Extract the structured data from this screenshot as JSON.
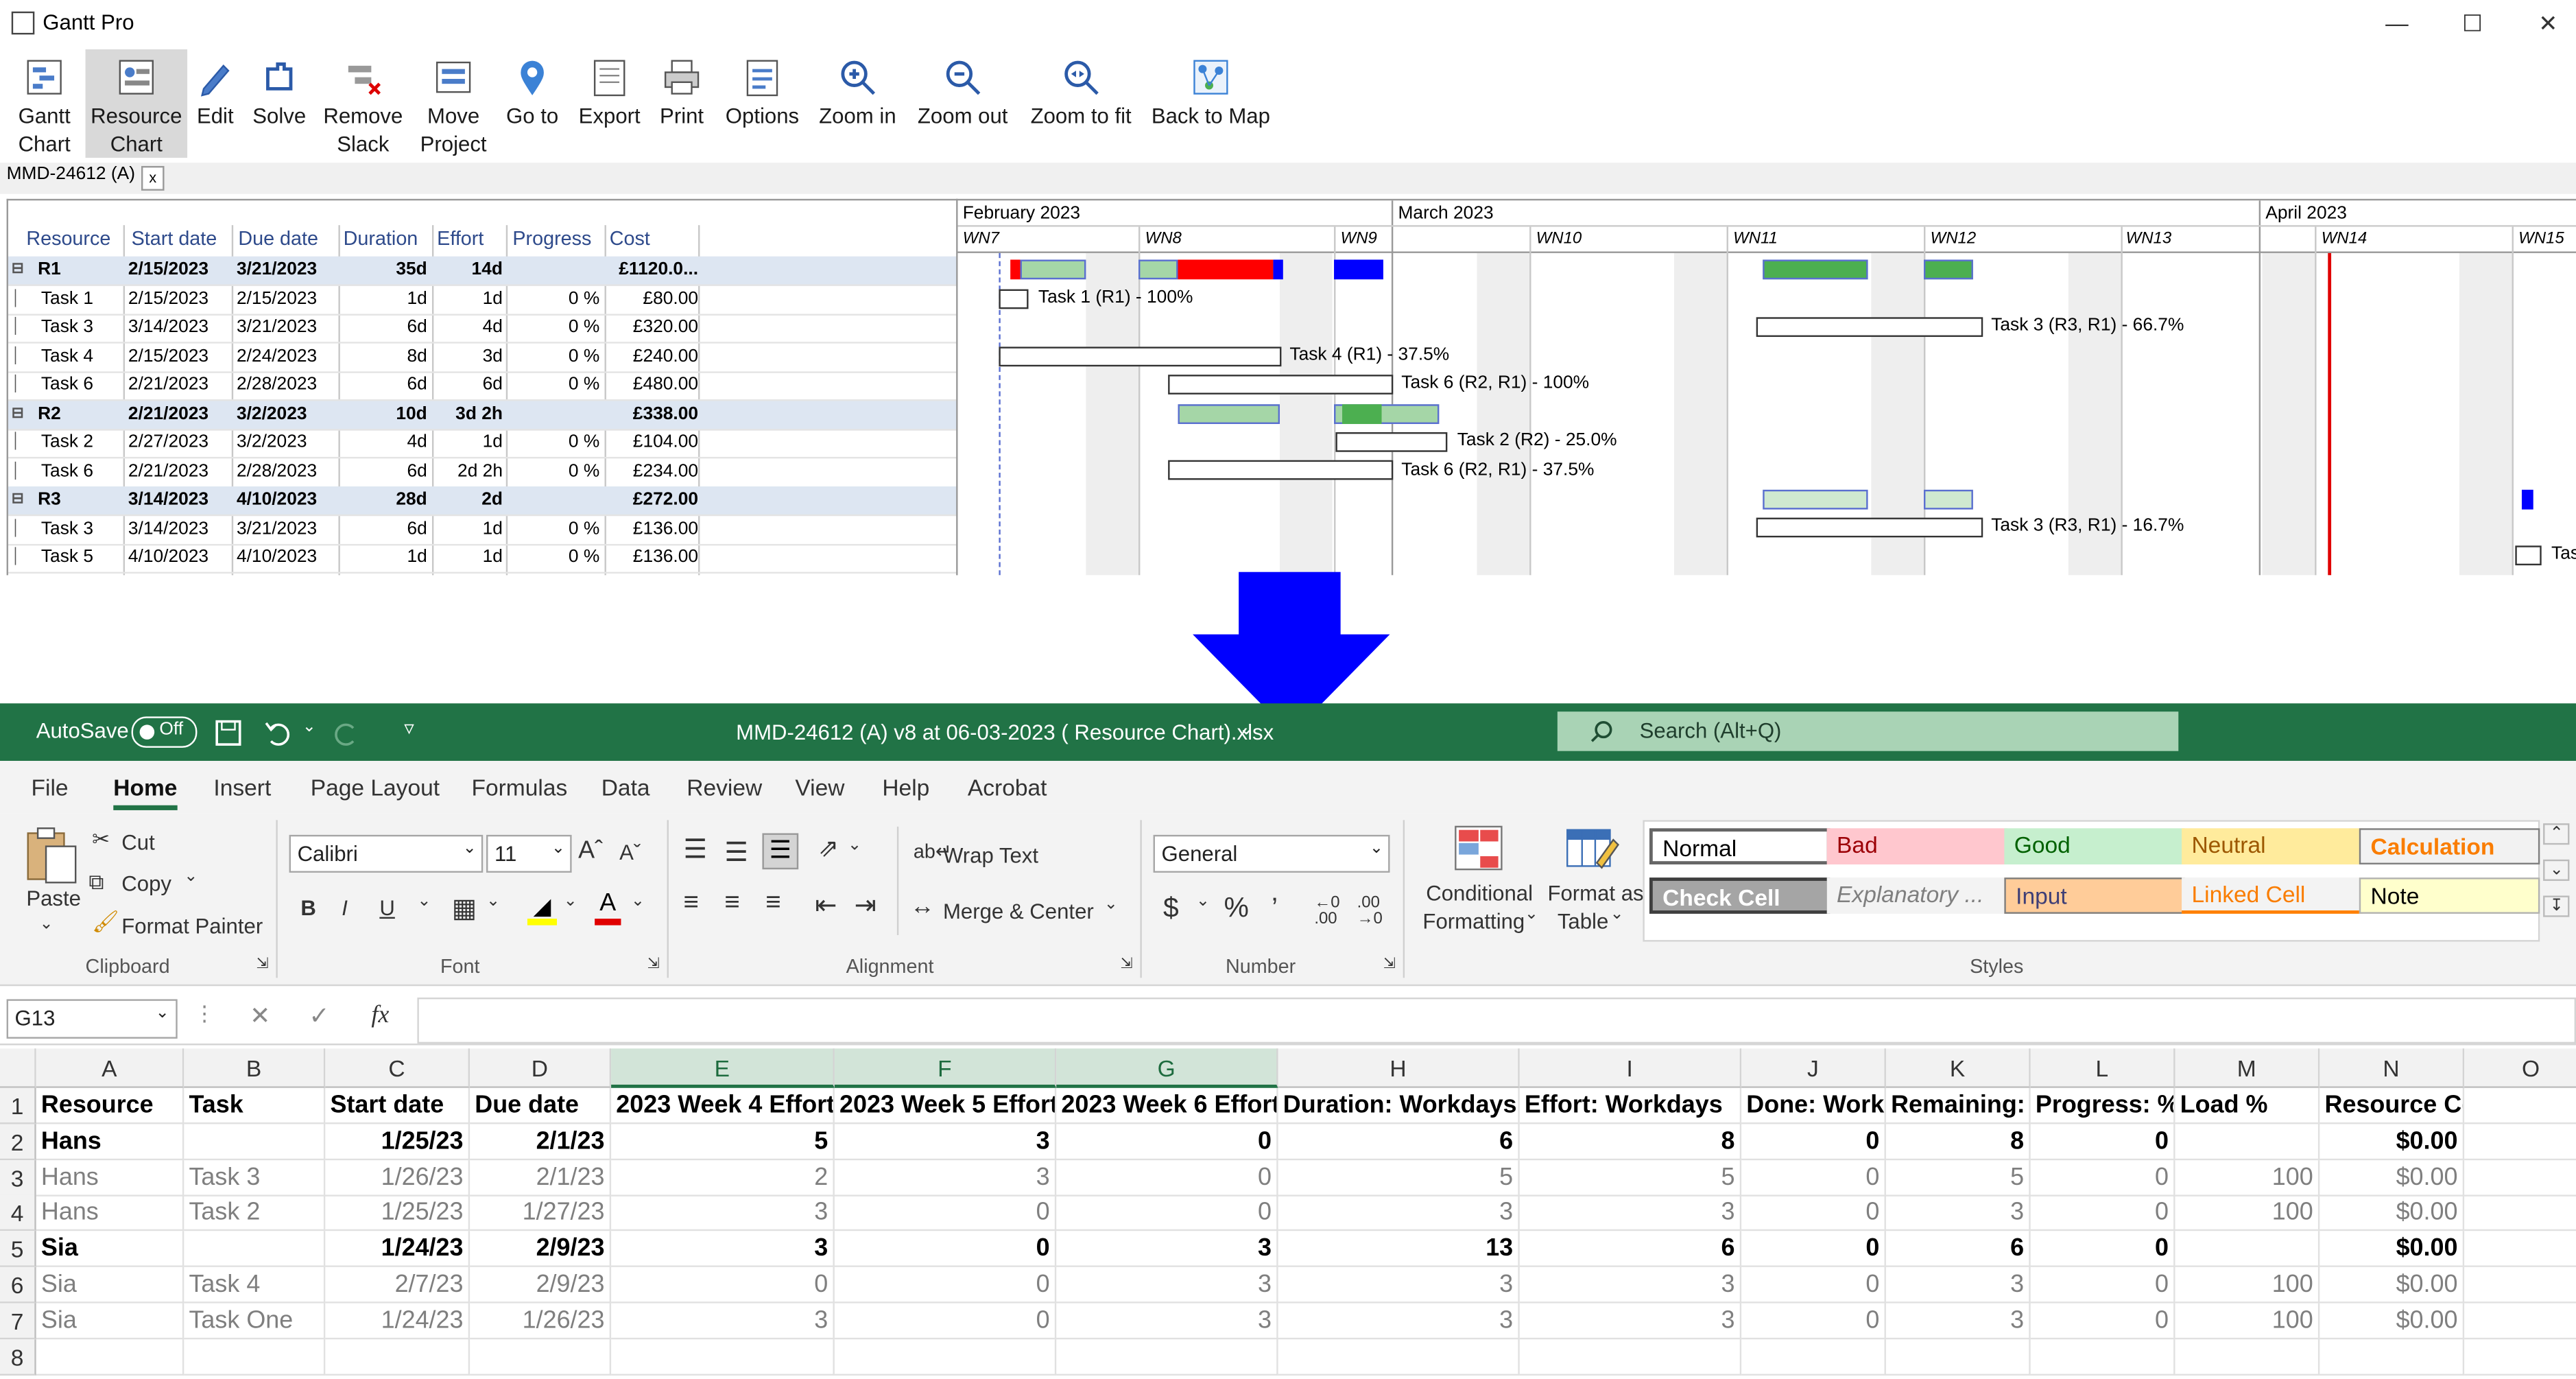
{
  "gantt": {
    "app_title": "Gantt Pro",
    "toolbar": [
      {
        "label1": "Gantt",
        "label2": "Chart",
        "icon": "gantt-chart-icon"
      },
      {
        "label1": "Resource",
        "label2": "Chart",
        "icon": "resource-chart-icon"
      },
      {
        "label1": "Edit",
        "label2": "",
        "icon": "pencil-icon"
      },
      {
        "label1": "Solve",
        "label2": "",
        "icon": "solve-icon"
      },
      {
        "label1": "Remove",
        "label2": "Slack",
        "icon": "remove-slack-icon"
      },
      {
        "label1": "Move",
        "label2": "Project",
        "icon": "move-project-icon"
      },
      {
        "label1": "Go to",
        "label2": "",
        "icon": "location-pin-icon"
      },
      {
        "label1": "Export",
        "label2": "",
        "icon": "export-icon"
      },
      {
        "label1": "Print",
        "label2": "",
        "icon": "printer-icon"
      },
      {
        "label1": "Options",
        "label2": "",
        "icon": "options-icon"
      },
      {
        "label1": "Zoom in",
        "label2": "",
        "icon": "zoom-in-icon"
      },
      {
        "label1": "Zoom out",
        "label2": "",
        "icon": "zoom-out-icon"
      },
      {
        "label1": "Zoom to fit",
        "label2": "",
        "icon": "zoom-fit-icon"
      },
      {
        "label1": "Back to Map",
        "label2": "",
        "icon": "map-icon"
      }
    ],
    "doc_tab": "MMD-24612 (A)",
    "doc_tab_close": "x",
    "columns": [
      "Resource",
      "Start date",
      "Due date",
      "Duration",
      "Effort",
      "Progress",
      "Cost"
    ],
    "rows": [
      {
        "resource": "R1",
        "start": "2/15/2023",
        "due": "3/21/2023",
        "duration": "35d",
        "effort": "14d",
        "progress": "",
        "cost": "£1120.0...",
        "is_group": true
      },
      {
        "resource": "Task 1",
        "start": "2/15/2023",
        "due": "2/15/2023",
        "duration": "1d",
        "effort": "1d",
        "progress": "0 %",
        "cost": "£80.00",
        "is_group": false
      },
      {
        "resource": "Task 3",
        "start": "3/14/2023",
        "due": "3/21/2023",
        "duration": "6d",
        "effort": "4d",
        "progress": "0 %",
        "cost": "£320.00",
        "is_group": false
      },
      {
        "resource": "Task 4",
        "start": "2/15/2023",
        "due": "2/24/2023",
        "duration": "8d",
        "effort": "3d",
        "progress": "0 %",
        "cost": "£240.00",
        "is_group": false
      },
      {
        "resource": "Task 6",
        "start": "2/21/2023",
        "due": "2/28/2023",
        "duration": "6d",
        "effort": "6d",
        "progress": "0 %",
        "cost": "£480.00",
        "is_group": false
      },
      {
        "resource": "R2",
        "start": "2/21/2023",
        "due": "3/2/2023",
        "duration": "10d",
        "effort": "3d 2h",
        "progress": "",
        "cost": "£338.00",
        "is_group": true
      },
      {
        "resource": "Task 2",
        "start": "2/27/2023",
        "due": "3/2/2023",
        "duration": "4d",
        "effort": "1d",
        "progress": "0 %",
        "cost": "£104.00",
        "is_group": false
      },
      {
        "resource": "Task 6",
        "start": "2/21/2023",
        "due": "2/28/2023",
        "duration": "6d",
        "effort": "2d 2h",
        "progress": "0 %",
        "cost": "£234.00",
        "is_group": false
      },
      {
        "resource": "R3",
        "start": "3/14/2023",
        "due": "4/10/2023",
        "duration": "28d",
        "effort": "2d",
        "progress": "",
        "cost": "£272.00",
        "is_group": true
      },
      {
        "resource": "Task 3",
        "start": "3/14/2023",
        "due": "3/21/2023",
        "duration": "6d",
        "effort": "1d",
        "progress": "0 %",
        "cost": "£136.00",
        "is_group": false
      },
      {
        "resource": "Task 5",
        "start": "4/10/2023",
        "due": "4/10/2023",
        "duration": "1d",
        "effort": "1d",
        "progress": "0 %",
        "cost": "£136.00",
        "is_group": false
      }
    ],
    "months": [
      "February 2023",
      "March 2023",
      "April 2023"
    ],
    "weeks": [
      "WN7",
      "WN8",
      "WN9",
      "WN10",
      "WN11",
      "WN12",
      "WN13",
      "WN14",
      "WN15"
    ],
    "bar_labels": [
      "Task 1 (R1) - 100%",
      "Task 3 (R3, R1) - 66.7%",
      "Task 4 (R1) - 37.5%",
      "Task 6 (R2, R1) - 100%",
      "Task 2 (R2) - 25.0%",
      "Task 6 (R2, R1) - 37.5%",
      "Task 3 (R3, R1) - 16.7%",
      "Tas"
    ],
    "colors": {
      "load_ok": "#4caf50",
      "overload": "#ff0000",
      "light": "#a5d6a7",
      "blue": "#0000ff",
      "today": "#e00000"
    }
  },
  "excel": {
    "autosave_label": "AutoSave",
    "autosave_state": "Off",
    "file_title": "MMD-24612 (A) v8 at 06-03-2023 ( Resource Chart).xlsx",
    "search_placeholder": "Search (Alt+Q)",
    "tabs": [
      "File",
      "Home",
      "Insert",
      "Page Layout",
      "Formulas",
      "Data",
      "Review",
      "View",
      "Help",
      "Acrobat"
    ],
    "clipboard": {
      "paste": "Paste",
      "cut": "Cut",
      "copy": "Copy",
      "format_painter": "Format Painter",
      "group": "Clipboard"
    },
    "font": {
      "name": "Calibri",
      "size": "11",
      "group": "Font"
    },
    "alignment": {
      "wrap": "Wrap Text",
      "merge": "Merge & Center",
      "group": "Alignment"
    },
    "number": {
      "format": "General",
      "group": "Number"
    },
    "styles": {
      "cond_fmt1": "Conditional",
      "cond_fmt2": "Formatting",
      "fmt_table1": "Format as",
      "fmt_table2": "Table",
      "group": "Styles",
      "items": [
        {
          "label": "Normal",
          "bg": "#ffffff",
          "fg": "#000000"
        },
        {
          "label": "Bad",
          "bg": "#ffc7ce",
          "fg": "#9c0006"
        },
        {
          "label": "Good",
          "bg": "#c6efce",
          "fg": "#006100"
        },
        {
          "label": "Neutral",
          "bg": "#ffeb9c",
          "fg": "#9c5700"
        },
        {
          "label": "Calculation",
          "bg": "#f2f2f2",
          "fg": "#fa7d00"
        },
        {
          "label": "Check Cell",
          "bg": "#a5a5a5",
          "fg": "#ffffff"
        },
        {
          "label": "Explanatory ...",
          "bg": "#f3f3f3",
          "fg": "#7f7f7f"
        },
        {
          "label": "Input",
          "bg": "#ffcc99",
          "fg": "#3f3f76"
        },
        {
          "label": "Linked Cell",
          "bg": "#f3f3f3",
          "fg": "#fa7d00"
        },
        {
          "label": "Note",
          "bg": "#ffffcc",
          "fg": "#000000"
        }
      ]
    },
    "name_box": "G13",
    "formula_fx": "fx",
    "col_letters": [
      "A",
      "B",
      "C",
      "D",
      "E",
      "F",
      "G",
      "H",
      "I",
      "J",
      "K",
      "L",
      "M",
      "N",
      "O"
    ],
    "row_numbers": [
      "1",
      "2",
      "3",
      "4",
      "5",
      "6",
      "7",
      "8"
    ],
    "headers": [
      "Resource",
      "Task",
      "Start date",
      "Due date",
      "2023 Week 4 Effort",
      "2023 Week 5 Effort",
      "2023 Week 6 Effort",
      "Duration: Workdays",
      "Effort: Workdays",
      "Done: Workd",
      "Remaining: W",
      "Progress: %",
      "Load %",
      "Resource Cost"
    ],
    "data": [
      [
        "Hans",
        "",
        "1/25/23",
        "2/1/23",
        "5",
        "3",
        "0",
        "6",
        "8",
        "0",
        "8",
        "0",
        "",
        "$0.00"
      ],
      [
        "Hans",
        "Task 3",
        "1/26/23",
        "2/1/23",
        "2",
        "3",
        "0",
        "5",
        "5",
        "0",
        "5",
        "0",
        "100",
        "$0.00"
      ],
      [
        "Hans",
        "Task 2",
        "1/25/23",
        "1/27/23",
        "3",
        "0",
        "0",
        "3",
        "3",
        "0",
        "3",
        "0",
        "100",
        "$0.00"
      ],
      [
        "Sia",
        "",
        "1/24/23",
        "2/9/23",
        "3",
        "0",
        "3",
        "13",
        "6",
        "0",
        "6",
        "0",
        "",
        "$0.00"
      ],
      [
        "Sia",
        "Task 4",
        "2/7/23",
        "2/9/23",
        "0",
        "0",
        "3",
        "3",
        "3",
        "0",
        "3",
        "0",
        "100",
        "$0.00"
      ],
      [
        "Sia",
        "Task One",
        "1/24/23",
        "1/26/23",
        "3",
        "0",
        "3",
        "3",
        "3",
        "0",
        "3",
        "0",
        "100",
        "$0.00"
      ]
    ],
    "bold_rows": [
      0,
      3
    ]
  }
}
